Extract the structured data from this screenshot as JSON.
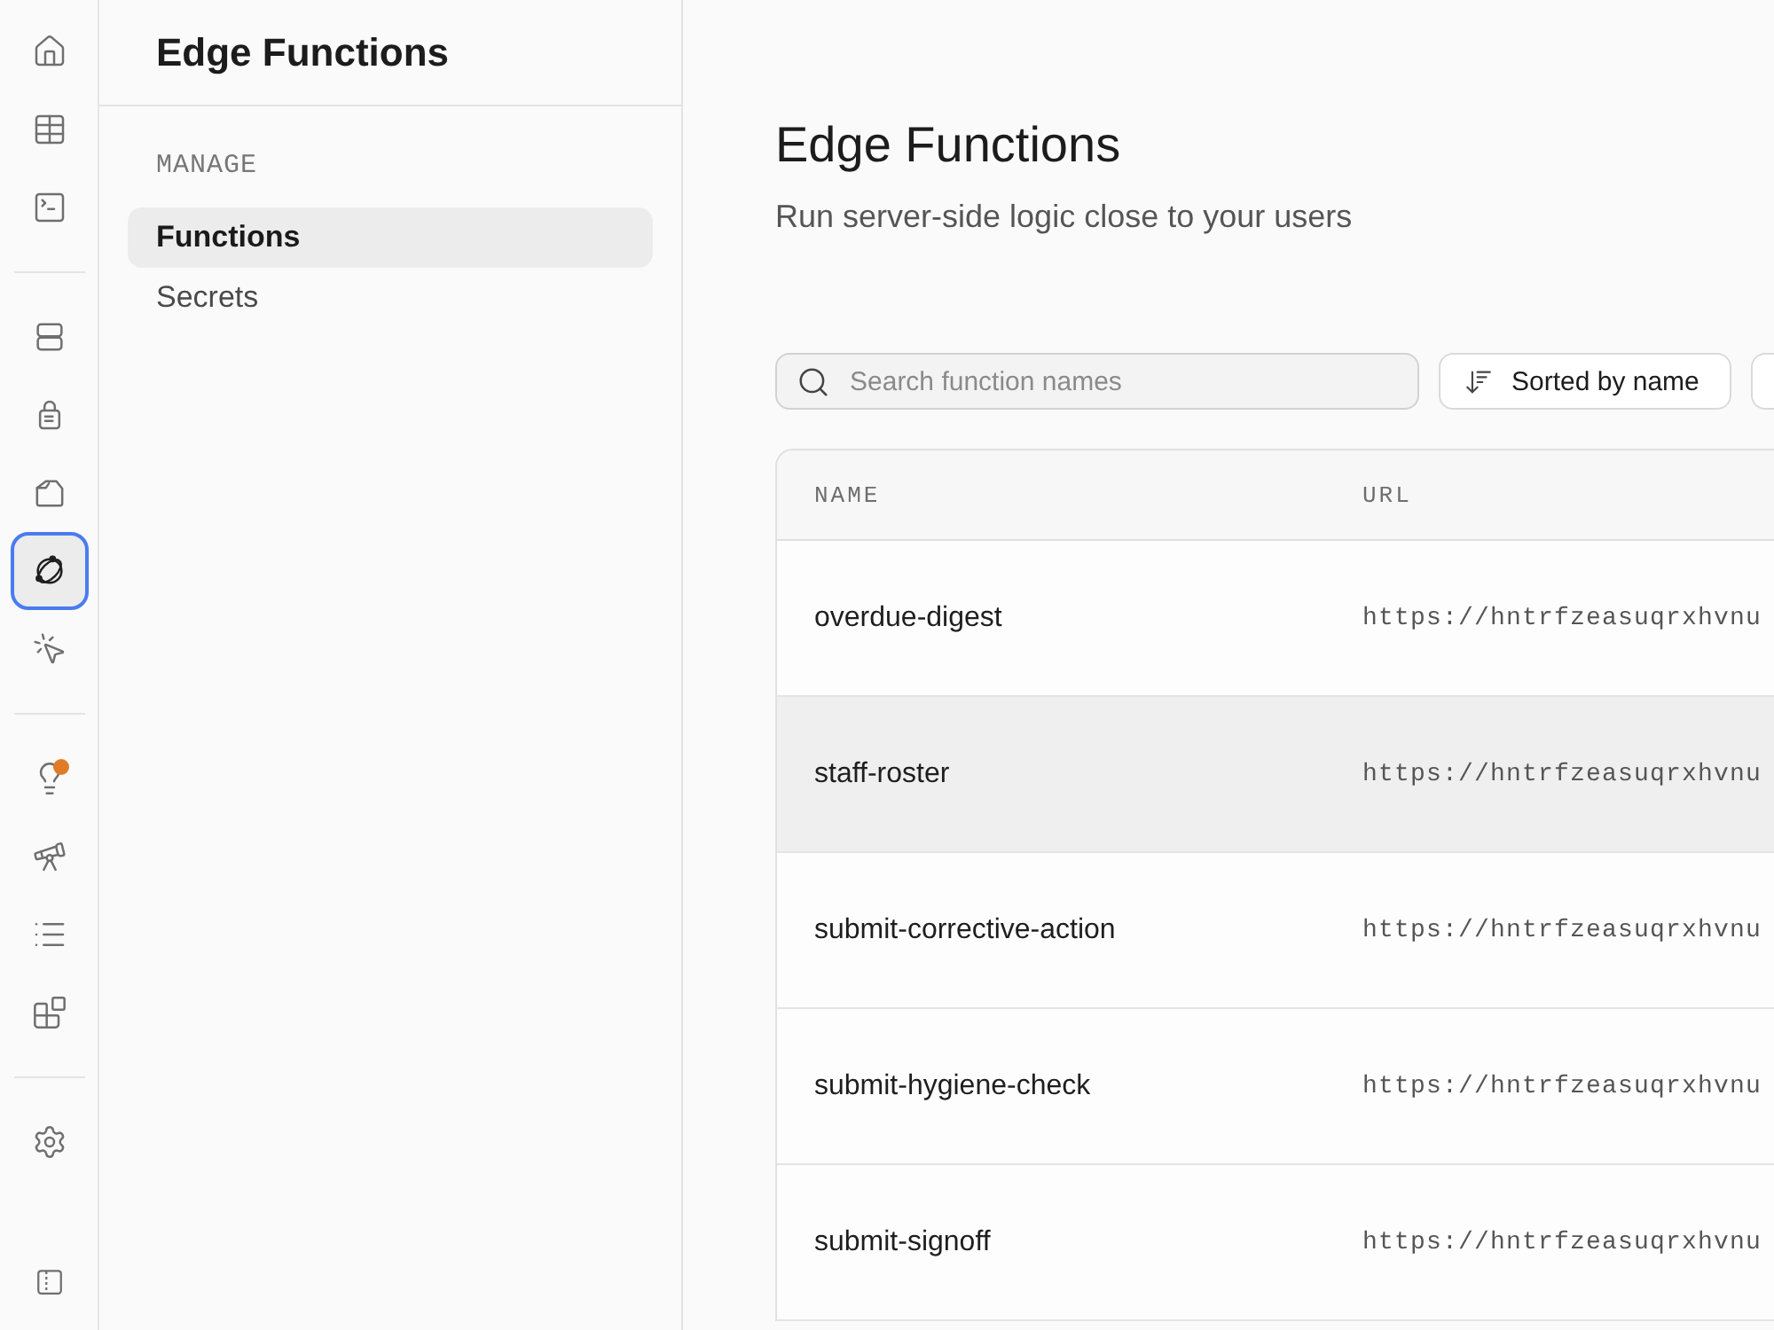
{
  "rail": {
    "groups": [
      {
        "items": [
          {
            "selected": false,
            "notification": false
          },
          {
            "selected": false,
            "notification": false
          },
          {
            "selected": false,
            "notification": false
          }
        ]
      },
      {
        "items": [
          {
            "selected": false,
            "notification": false
          },
          {
            "selected": false,
            "notification": false
          },
          {
            "selected": false,
            "notification": false
          },
          {
            "selected": true,
            "notification": false
          },
          {
            "selected": false,
            "notification": false
          }
        ]
      },
      {
        "items": [
          {
            "selected": false,
            "notification": true
          },
          {
            "selected": false,
            "notification": false
          },
          {
            "selected": false,
            "notification": false
          },
          {
            "selected": false,
            "notification": false
          }
        ]
      },
      {
        "items": [
          {
            "selected": false,
            "notification": false
          }
        ]
      }
    ]
  },
  "sidebar": {
    "title": "Edge Functions",
    "sections": [
      {
        "heading": "MANAGE",
        "items": [
          {
            "label": "Functions",
            "selected": true
          },
          {
            "label": "Secrets",
            "selected": false
          }
        ]
      }
    ]
  },
  "page": {
    "title": "Edge Functions",
    "subtitle": "Run server-side logic close to your users"
  },
  "toolbar": {
    "search": {
      "placeholder": "Search function names"
    },
    "sort_button": {
      "label": "Sorted by name"
    }
  },
  "table": {
    "columns": [
      "NAME",
      "URL"
    ],
    "rows": [
      {
        "name": "overdue-digest",
        "url": "https://hntrfzeasuqrxhvnu",
        "selected": false
      },
      {
        "name": "staff-roster",
        "url": "https://hntrfzeasuqrxhvnu",
        "selected": true
      },
      {
        "name": "submit-corrective-action",
        "url": "https://hntrfzeasuqrxhvnu",
        "selected": false
      },
      {
        "name": "submit-hygiene-check",
        "url": "https://hntrfzeasuqrxhvnu",
        "selected": false
      },
      {
        "name": "submit-signoff",
        "url": "https://hntrfzeasuqrxhvnu",
        "selected": false
      }
    ]
  }
}
